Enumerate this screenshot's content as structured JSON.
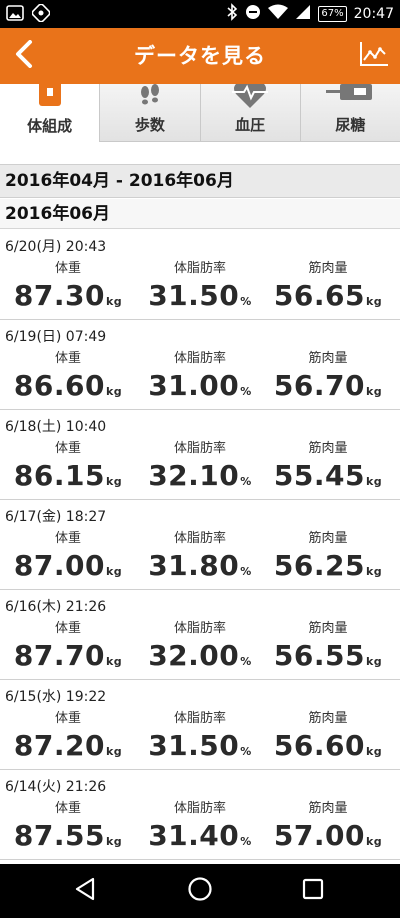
{
  "status_bar": {
    "time": "20:47",
    "battery": "67%"
  },
  "app_bar": {
    "title": "データを見る"
  },
  "tabs": [
    {
      "label": "体組成",
      "active": true
    },
    {
      "label": "歩数",
      "active": false
    },
    {
      "label": "血圧",
      "active": false
    },
    {
      "label": "尿糖",
      "active": false
    }
  ],
  "range_header": "2016年04月 - 2016年06月",
  "month_header": "2016年06月",
  "metric_labels": {
    "weight": "体重",
    "body_fat": "体脂肪率",
    "muscle": "筋肉量"
  },
  "units": {
    "kg": "kg",
    "percent": "%"
  },
  "records": [
    {
      "date": "6/20(月) 20:43",
      "weight": "87.30",
      "body_fat": "31.50",
      "muscle": "56.65"
    },
    {
      "date": "6/19(日) 07:49",
      "weight": "86.60",
      "body_fat": "31.00",
      "muscle": "56.70"
    },
    {
      "date": "6/18(土) 10:40",
      "weight": "86.15",
      "body_fat": "32.10",
      "muscle": "55.45"
    },
    {
      "date": "6/17(金) 18:27",
      "weight": "87.00",
      "body_fat": "31.80",
      "muscle": "56.25"
    },
    {
      "date": "6/16(木) 21:26",
      "weight": "87.70",
      "body_fat": "32.00",
      "muscle": "56.55"
    },
    {
      "date": "6/15(水) 19:22",
      "weight": "87.20",
      "body_fat": "31.50",
      "muscle": "56.60"
    },
    {
      "date": "6/14(火) 21:26",
      "weight": "87.55",
      "body_fat": "31.40",
      "muscle": "57.00"
    }
  ],
  "colors": {
    "accent": "#e9731a",
    "status_bar": "#000000",
    "nav_bar": "#000000"
  },
  "icons": {
    "back": "chevron-left-icon",
    "graph": "line-graph-icon",
    "tab_body": "scale-icon",
    "tab_steps": "footprints-icon",
    "tab_bp": "heart-pulse-icon",
    "tab_glucose": "glucose-meter-icon"
  }
}
